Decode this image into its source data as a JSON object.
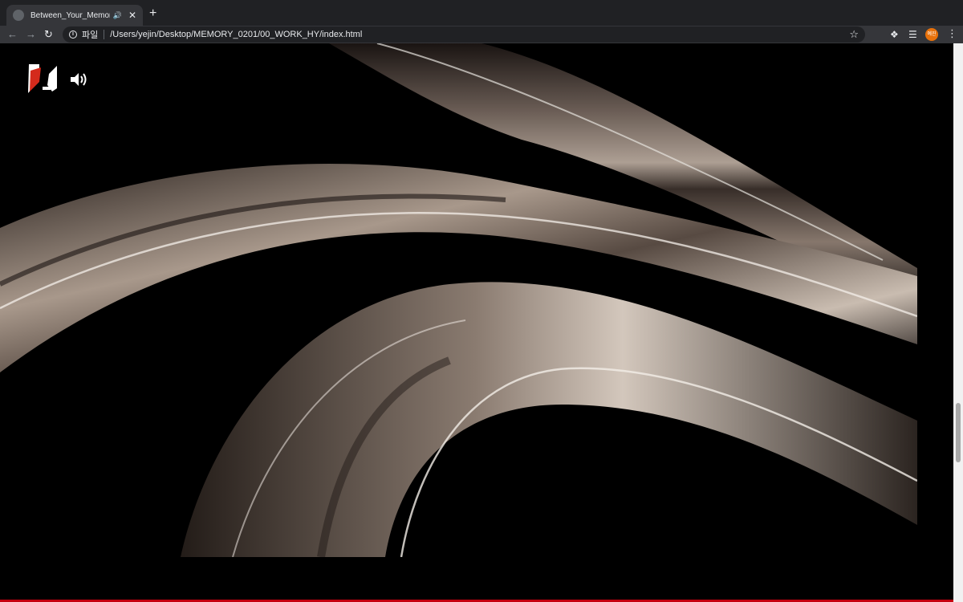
{
  "browser": {
    "tab": {
      "title": "Between_Your_Memories"
    },
    "address": {
      "scheme_label": "파일",
      "url": "/Users/yejin/Desktop/MEMORY_0201/00_WORK_HY/index.html"
    },
    "profile_label": "예진",
    "colors": {
      "tabstrip": "#202124",
      "toolbar": "#35363a",
      "omnibox": "#202124",
      "profile": "#e8710a"
    }
  },
  "page": {
    "background": "#000000",
    "accent_bar_color": "#c4000e",
    "icons": [
      "logo-mark",
      "speaker-volume-icon"
    ]
  }
}
